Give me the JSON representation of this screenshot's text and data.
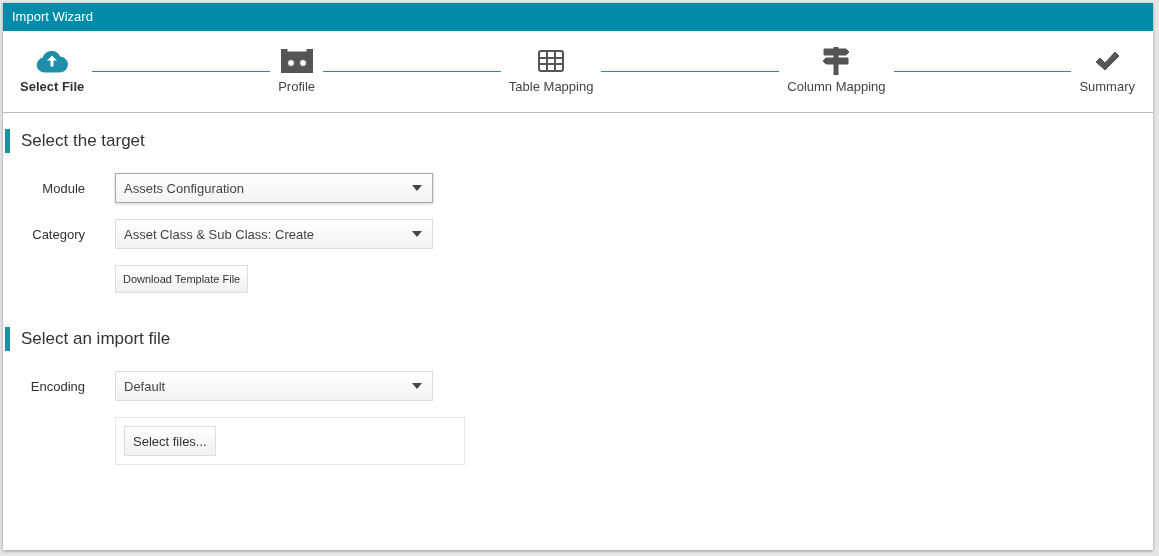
{
  "window": {
    "title": "Import Wizard"
  },
  "steps": [
    {
      "label": "Select File",
      "selected": true
    },
    {
      "label": "Profile",
      "selected": false
    },
    {
      "label": "Table Mapping",
      "selected": false
    },
    {
      "label": "Column Mapping",
      "selected": false
    },
    {
      "label": "Summary",
      "selected": false
    }
  ],
  "sections": [
    {
      "heading": "Select the target",
      "fields": [
        {
          "kind": "dropdown",
          "label": "Module",
          "value": "Assets Configuration",
          "focused": true
        },
        {
          "kind": "dropdown",
          "label": "Category",
          "value": "Asset Class & Sub Class: Create",
          "focused": false
        },
        {
          "kind": "button",
          "label": "Download Template File"
        }
      ]
    },
    {
      "heading": "Select an import file",
      "fields": [
        {
          "kind": "dropdown",
          "label": "Encoding",
          "value": "Default",
          "focused": false
        },
        {
          "kind": "upload",
          "label": "Select files..."
        }
      ]
    }
  ]
}
